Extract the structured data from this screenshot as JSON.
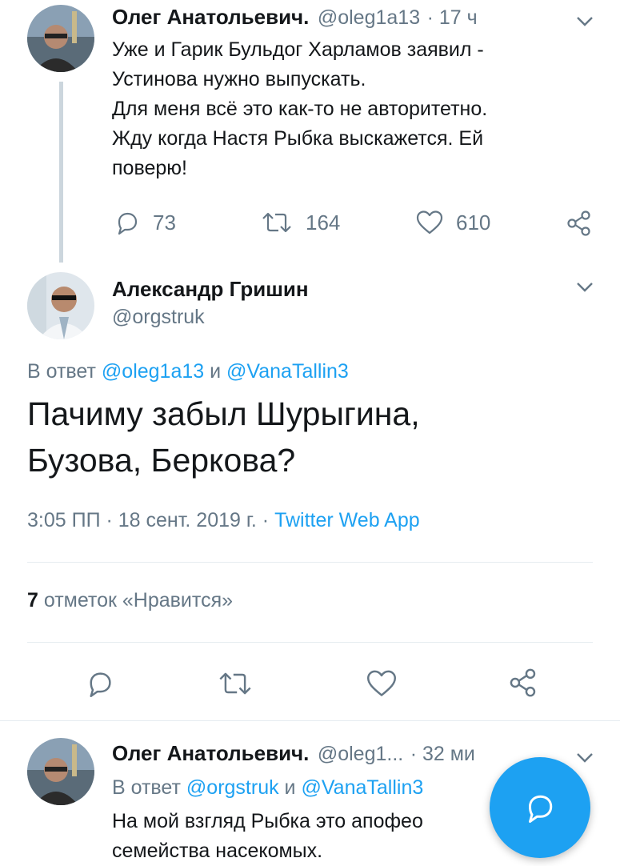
{
  "tweet1": {
    "name": "Олег Анатольевич.",
    "handle": "@oleg1a13",
    "time": "· 17 ч",
    "text_lines": [
      "Уже и Гарик Бульдог Харламов заявил -",
      "Устинова нужно выпускать.",
      "Для меня всё это как-то не авторитетно.",
      "Жду когда Настя Рыбка выскажется. Ей",
      "поверю!"
    ],
    "replies": "73",
    "retweets": "164",
    "likes": "610"
  },
  "tweet2": {
    "name": "Александр Гришин",
    "handle": "@orgstruk",
    "reply_prefix": "В ответ",
    "reply_to_1": "@oleg1a13",
    "reply_and": "и",
    "reply_to_2": "@VanaTallin3",
    "text_line1": "Пачиму забыл Шурыгина,",
    "text_line2": "Бузова, Беркова?",
    "timestamp": "3:05 ПП · 18 сент. 2019 г. ·",
    "source": "Twitter Web App",
    "likes_count": "7",
    "likes_label": "отметок «Нравится»"
  },
  "tweet3": {
    "name": "Олег Анатольевич.",
    "handle": "@oleg1...",
    "time": "· 32 ми",
    "reply_prefix": "В ответ",
    "reply_to_1": "@orgstruk",
    "reply_and": "и",
    "reply_to_2": "@VanaTallin3",
    "text_line1": "На мой взгляд Рыбка это апофео",
    "text_line2": "семейства насекомых."
  },
  "colors": {
    "accent": "#1da1f2",
    "muted": "#657786",
    "text": "#14171a",
    "divider": "#e6ecf0"
  },
  "icons": [
    "reply-icon",
    "retweet-icon",
    "like-icon",
    "share-icon",
    "chevron-down-icon",
    "compose-icon"
  ]
}
